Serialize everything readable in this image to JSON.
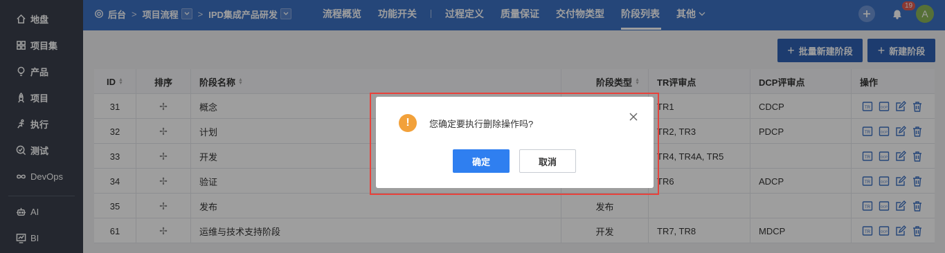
{
  "sidebar": {
    "items": [
      {
        "label": "地盘",
        "icon": "home-icon"
      },
      {
        "label": "项目集",
        "icon": "grid-icon"
      },
      {
        "label": "产品",
        "icon": "bulb-icon"
      },
      {
        "label": "项目",
        "icon": "rocket-icon"
      },
      {
        "label": "执行",
        "icon": "run-icon"
      },
      {
        "label": "测试",
        "icon": "search-check-icon"
      },
      {
        "label": "DevOps",
        "icon": "infinity-icon"
      },
      {
        "label": "AI",
        "icon": "robot-icon"
      },
      {
        "label": "BI",
        "icon": "chart-icon"
      }
    ]
  },
  "header": {
    "crumbs": [
      "后台",
      "项目流程",
      "IPD集成产品研发"
    ],
    "nav": [
      "流程概览",
      "功能开关",
      "过程定义",
      "质量保证",
      "交付物类型",
      "阶段列表",
      "其他"
    ],
    "active_nav": "阶段列表",
    "notification_count": "19",
    "avatar_letter": "A"
  },
  "toolbar": {
    "batch_new_label": "批量新建阶段",
    "new_label": "新建阶段"
  },
  "table": {
    "columns": [
      "ID",
      "排序",
      "阶段名称",
      "阶段类型",
      "TR评审点",
      "DCP评审点",
      "操作"
    ],
    "rows": [
      {
        "id": "31",
        "name": "概念",
        "type": "",
        "tr": "TR1",
        "dcp": "CDCP"
      },
      {
        "id": "32",
        "name": "计划",
        "type": "",
        "tr": "TR2, TR3",
        "dcp": "PDCP"
      },
      {
        "id": "33",
        "name": "开发",
        "type": "",
        "tr": "TR4, TR4A, TR5",
        "dcp": ""
      },
      {
        "id": "34",
        "name": "验证",
        "type": "",
        "tr": "TR6",
        "dcp": "ADCP"
      },
      {
        "id": "35",
        "name": "发布",
        "type": "发布",
        "tr": "",
        "dcp": ""
      },
      {
        "id": "61",
        "name": "运维与技术支持阶段",
        "type": "开发",
        "tr": "TR7, TR8",
        "dcp": "MDCP"
      }
    ]
  },
  "dialog": {
    "message": "您确定要执行删除操作吗?",
    "ok_label": "确定",
    "cancel_label": "取消"
  }
}
